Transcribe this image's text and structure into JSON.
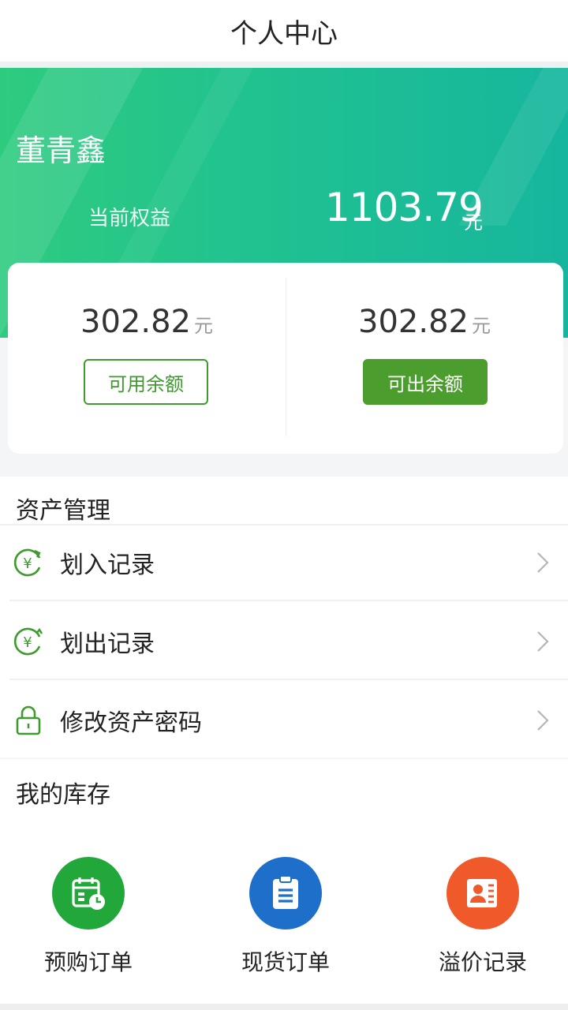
{
  "header": {
    "title": "个人中心"
  },
  "account": {
    "user_name": "董青鑫",
    "equity_label": "当前权益",
    "equity_value": "1103.79",
    "equity_unit": "元"
  },
  "balances": {
    "available": {
      "amount": "302.82",
      "unit": "元",
      "label": "可用余额"
    },
    "withdrawable": {
      "amount": "302.82",
      "unit": "元",
      "label": "可出余额"
    }
  },
  "asset_management": {
    "title": "资产管理",
    "items": [
      {
        "label": "划入记录",
        "icon": "transfer-in-icon"
      },
      {
        "label": "划出记录",
        "icon": "transfer-out-icon"
      },
      {
        "label": "修改资产密码",
        "icon": "lock-icon"
      }
    ]
  },
  "inventory": {
    "title": "我的库存",
    "items": [
      {
        "label": "预购订单",
        "icon": "calendar-clock-icon",
        "color": "#22a83a"
      },
      {
        "label": "现货订单",
        "icon": "clipboard-icon",
        "color": "#1d6fc9"
      },
      {
        "label": "溢价记录",
        "icon": "contact-card-icon",
        "color": "#f05a2a"
      }
    ]
  },
  "colors": {
    "brand_green": "#3f9b2f",
    "hero_start": "#2ecb7f",
    "hero_end": "#16b69e"
  }
}
